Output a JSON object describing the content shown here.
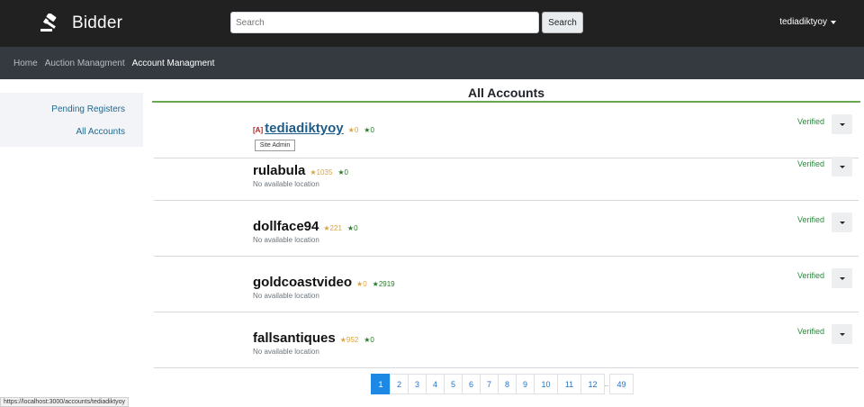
{
  "brand": {
    "name": "Bidder",
    "icon": "gavel-icon"
  },
  "search": {
    "placeholder": "Search",
    "button_label": "Search"
  },
  "user_menu": {
    "username": "tediadiktyoy"
  },
  "subnav": {
    "items": [
      "Home",
      "Auction Managment",
      "Account Managment"
    ],
    "active_index": 2
  },
  "sidebar": {
    "items": [
      "Pending Registers",
      "All Accounts"
    ]
  },
  "main": {
    "title": "All Accounts"
  },
  "accounts": [
    {
      "admin_tag": "[A]",
      "username": "tediadiktyoy",
      "seller_rating": "★0",
      "bidder_rating": "★0",
      "location": "",
      "status": "Verified",
      "tooltip": "Site Admin"
    },
    {
      "username": "rulabula",
      "seller_rating": "★1035",
      "bidder_rating": "★0",
      "location": "No available location",
      "status": "Verified"
    },
    {
      "username": "dollface94",
      "seller_rating": "★221",
      "bidder_rating": "★0",
      "location": "No available location",
      "status": "Verified"
    },
    {
      "username": "goldcoastvideo",
      "seller_rating": "★0",
      "bidder_rating": "★2919",
      "location": "No available location",
      "status": "Verified"
    },
    {
      "username": "fallsantiques",
      "seller_rating": "★952",
      "bidder_rating": "★0",
      "location": "No available location",
      "status": "Verified"
    }
  ],
  "pagination": {
    "pages": [
      "1",
      "2",
      "3",
      "4",
      "5",
      "6",
      "7",
      "8",
      "9",
      "10",
      "11",
      "12"
    ],
    "ellipsis": "...",
    "last_page": "49",
    "active_page": "1"
  },
  "status_bar": {
    "url": "https://localhost:3000/accounts/tediadiktyoy"
  },
  "colors": {
    "navbar": "#212121",
    "subnav": "#343a40",
    "accent_green": "#6aa84f",
    "active_page": "#1e88e5",
    "link": "#23698d"
  }
}
